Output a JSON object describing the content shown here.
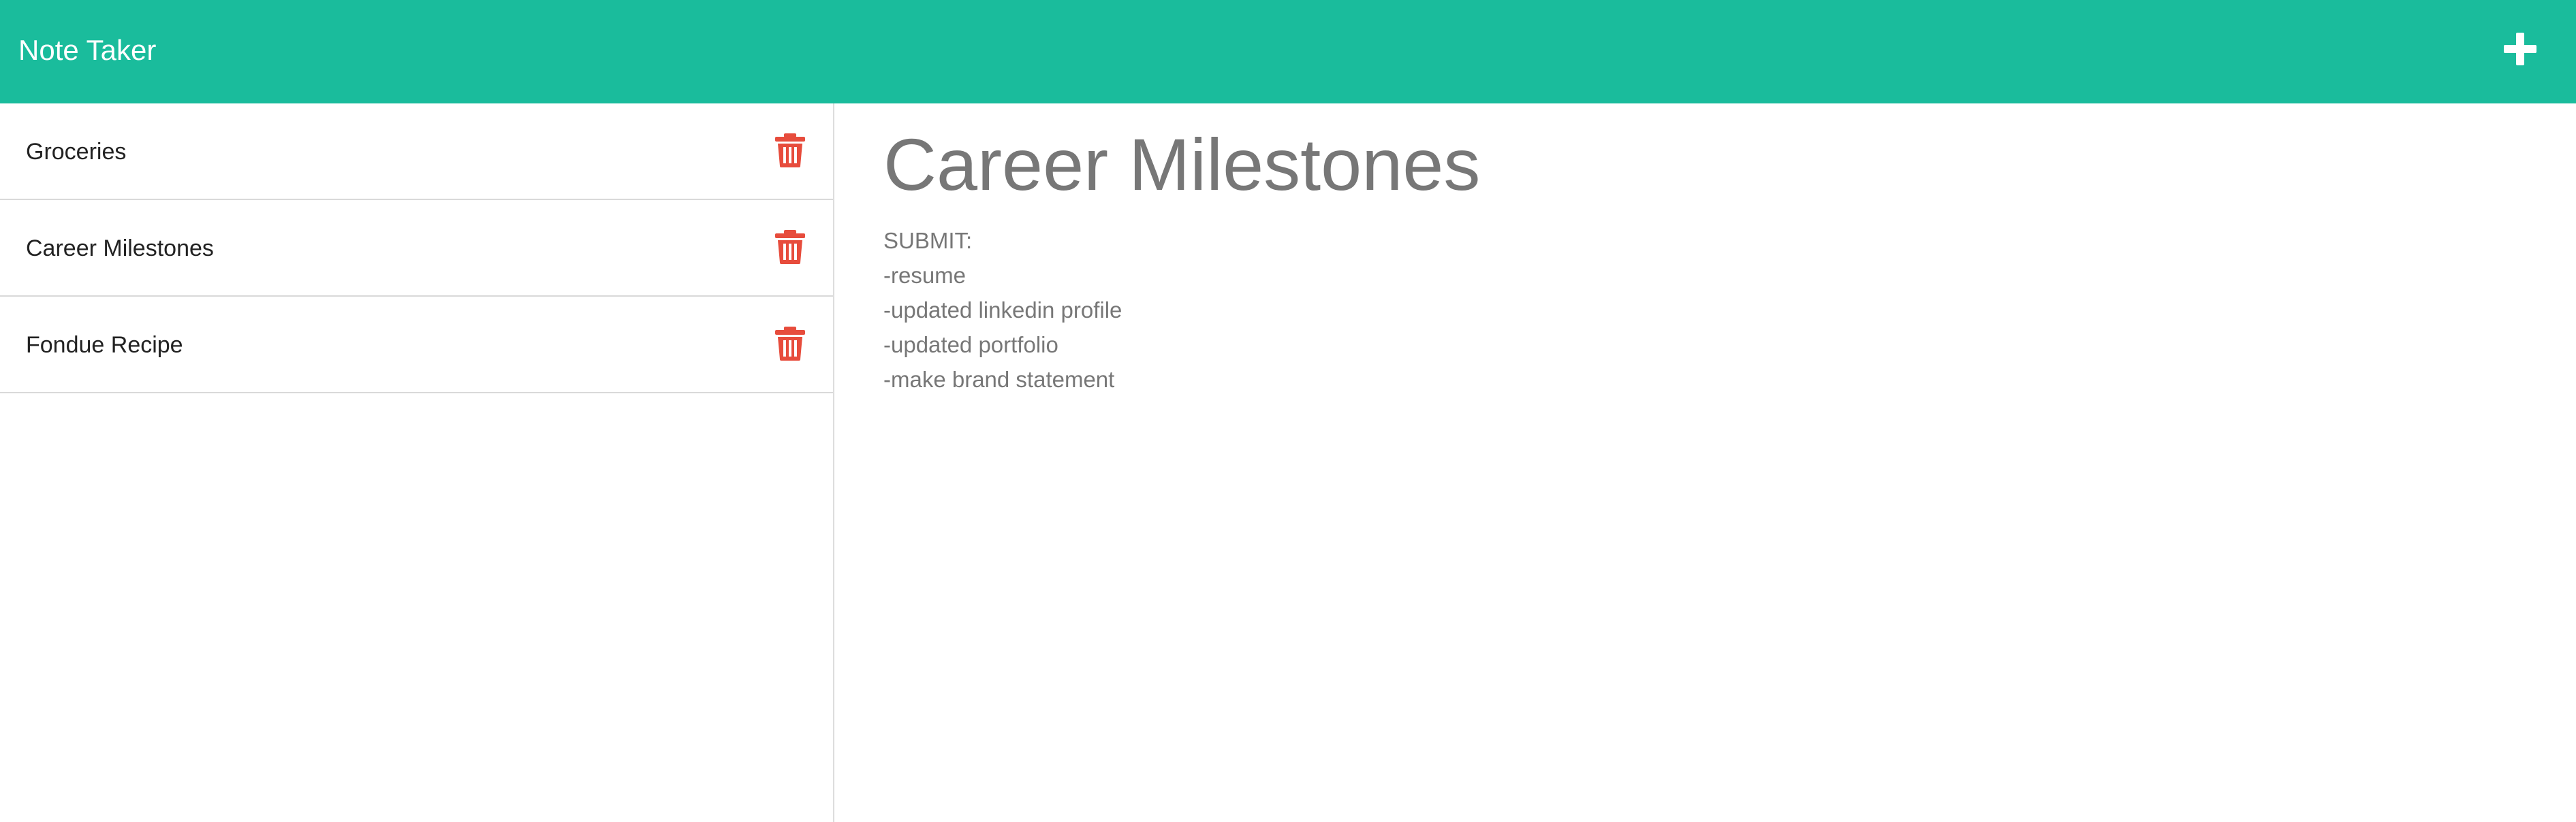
{
  "navbar": {
    "brand": "Note Taker",
    "new_note_icon": "plus-icon",
    "bg_color": "#1abc9c"
  },
  "sidebar": {
    "notes": [
      {
        "title": "Groceries",
        "delete_icon": "trash-icon"
      },
      {
        "title": "Career Milestones",
        "delete_icon": "trash-icon"
      },
      {
        "title": "Fondue Recipe",
        "delete_icon": "trash-icon"
      }
    ],
    "delete_color": "#e74c3c"
  },
  "main": {
    "note_title": "Career Milestones",
    "note_text": "SUBMIT:\n-resume\n-updated linkedin profile\n-updated portfolio\n-make brand statement"
  }
}
